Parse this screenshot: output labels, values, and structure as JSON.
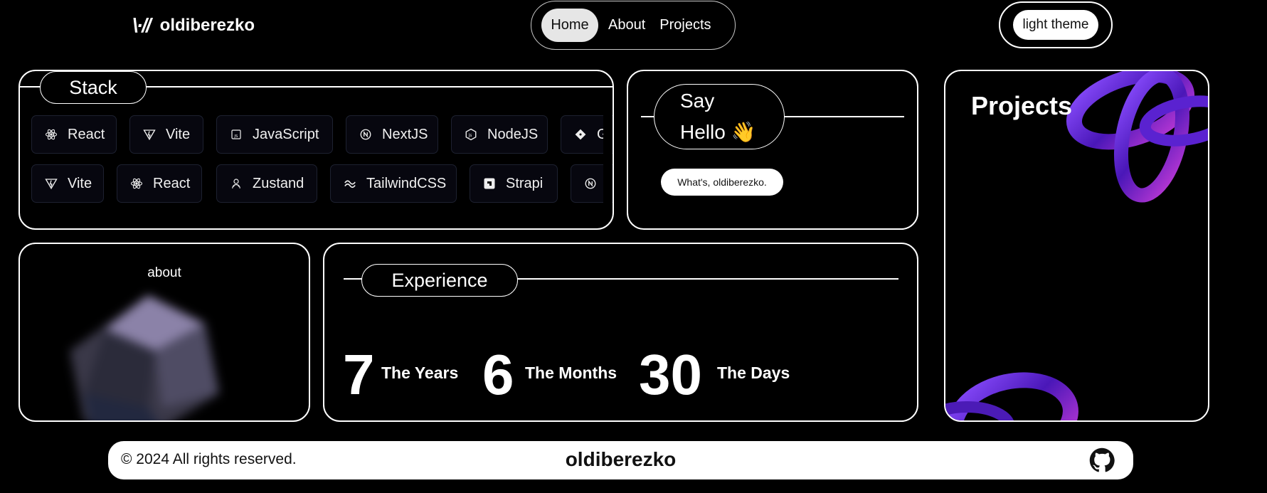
{
  "header": {
    "logo_mark": "\\·//",
    "brand": "oldiberezko",
    "nav": [
      {
        "label": "Home",
        "active": true
      },
      {
        "label": "About",
        "active": false
      },
      {
        "label": "Projects",
        "active": false
      }
    ],
    "theme_toggle": "light theme"
  },
  "stack": {
    "title": "Stack",
    "row1": [
      {
        "label": "React",
        "icon": "react-icon"
      },
      {
        "label": "Vite",
        "icon": "vite-icon"
      },
      {
        "label": "JavaScript",
        "icon": "javascript-icon"
      },
      {
        "label": "NextJS",
        "icon": "nextjs-icon"
      },
      {
        "label": "NodeJS",
        "icon": "nodejs-icon"
      },
      {
        "label": "G",
        "icon": "git-icon"
      }
    ],
    "row2": [
      {
        "label": "Vite",
        "icon": "vite-icon"
      },
      {
        "label": "React",
        "icon": "react-icon"
      },
      {
        "label": "Zustand",
        "icon": "zustand-icon"
      },
      {
        "label": "TailwindCSS",
        "icon": "tailwind-icon"
      },
      {
        "label": "Strapi",
        "icon": "strapi-icon"
      },
      {
        "label": "",
        "icon": "nextjs-icon"
      }
    ]
  },
  "hello": {
    "line1": "Say",
    "line2": "Hello 👋",
    "button": "What's, oldiberezko."
  },
  "projects": {
    "title": "Projects"
  },
  "about": {
    "label": "about"
  },
  "experience": {
    "title": "Experience",
    "stats": [
      {
        "value": "7",
        "label": "The Years"
      },
      {
        "value": "6",
        "label": "The Months"
      },
      {
        "value": "30",
        "label": "The Days"
      }
    ]
  },
  "footer": {
    "copyright": "© 2024 All rights reserved.",
    "brand": "oldiberezko",
    "github_icon": "github-icon"
  },
  "colors": {
    "background": "#000000",
    "accent_purple": "#6a2bd9",
    "chip_bg": "#07070f",
    "footer_bg": "#ffffff"
  }
}
